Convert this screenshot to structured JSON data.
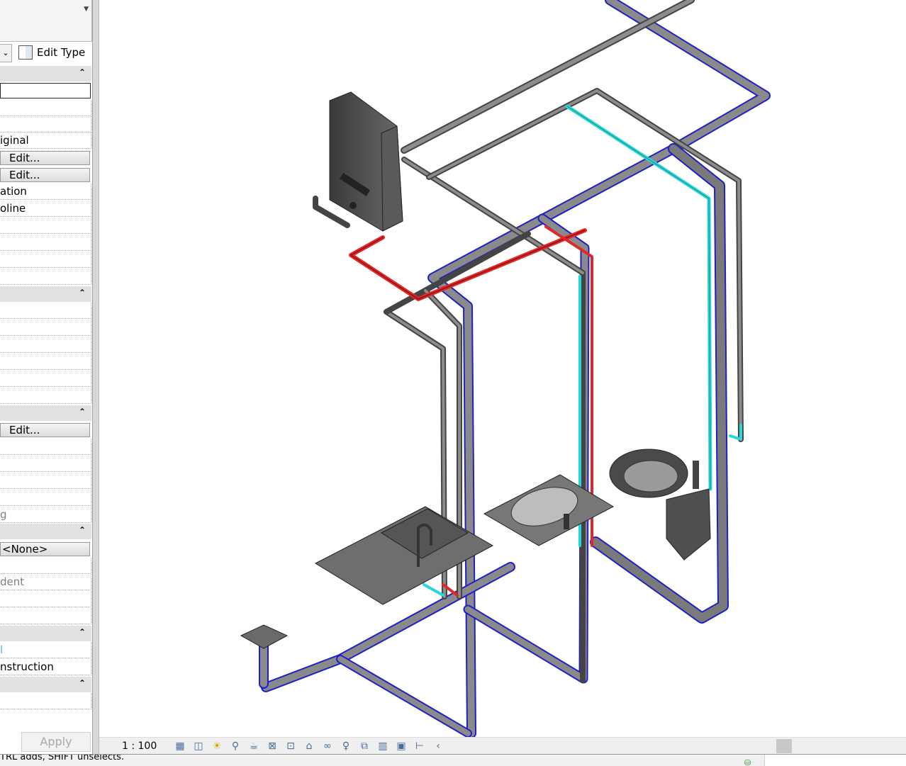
{
  "properties": {
    "edit_type_label": "Edit Type",
    "rows": {
      "r1": "iginal",
      "edit1": "Edit...",
      "edit2": "Edit...",
      "r2": "ation",
      "r3": "oline",
      "edit3": "Edit...",
      "r4": "g",
      "none": "<None>",
      "r5": "dent",
      "r6": "l",
      "r7": "nstruction"
    },
    "apply_label": "Apply"
  },
  "view_bar": {
    "scale": "1 : 100",
    "icons": [
      "detail-level-icon",
      "visual-style-icon",
      "sun-path-off-icon",
      "shadows-off-icon",
      "render-icon",
      "crop-view-icon",
      "show-crop-icon",
      "unlock-3d-view-icon",
      "temporary-hide-icon",
      "reveal-hidden-icon",
      "worksharing-icon",
      "design-options-icon",
      "analytical-model-icon",
      "constraints-icon",
      "collapse-icon"
    ],
    "icon_glyphs": [
      "▦",
      "◫",
      "☀",
      "⚲",
      "☕",
      "⊠",
      "⊡",
      "⌂",
      "∞",
      "♀",
      "⧉",
      "▥",
      "▣",
      "⊢",
      "‹"
    ]
  },
  "status_bar": {
    "text": "TRL adds, SHIFT unselects."
  },
  "colors": {
    "pipe_gray": "#6e6e6e",
    "pipe_blue": "#2020c8",
    "pipe_cyan": "#28d8d8",
    "pipe_red": "#e02828"
  }
}
